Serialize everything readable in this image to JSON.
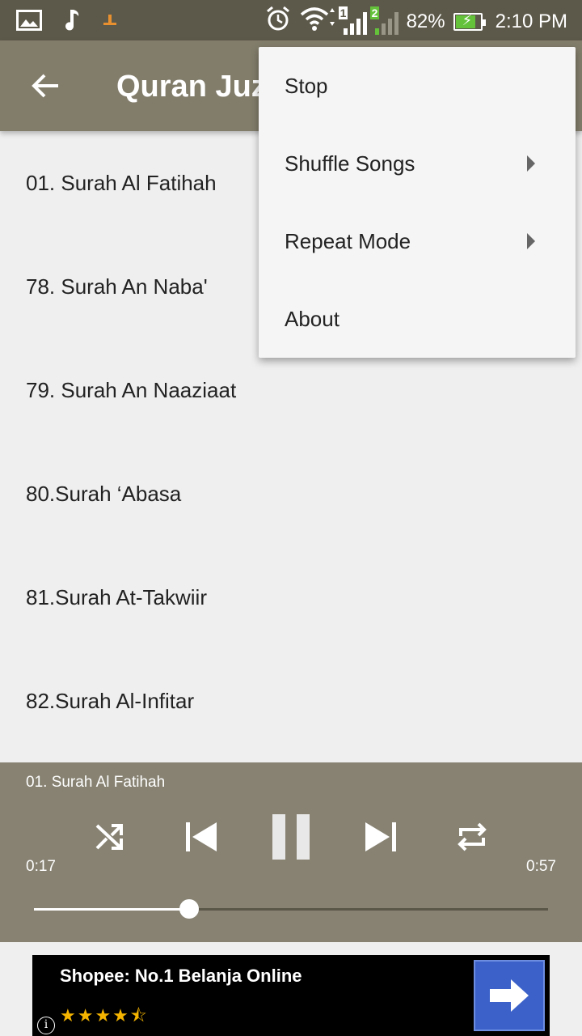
{
  "status_bar": {
    "battery": "82%",
    "time": "2:10 PM",
    "sim1": "1",
    "sim2": "2",
    "icons": [
      "gallery-icon",
      "music-note-icon",
      "notification-icon",
      "alarm-icon",
      "wifi-icon",
      "signal-icon",
      "battery-charging-icon"
    ],
    "battery_level": 0.82,
    "battery_color": "#64c23a"
  },
  "app_bar": {
    "title": "Quran Juz",
    "back_icon": "arrow-back-icon",
    "background": "#827d6b"
  },
  "tracks": [
    {
      "label": "01. Surah Al Fatihah"
    },
    {
      "label": "78. Surah An Naba'"
    },
    {
      "label": "79. Surah An Naaziaat"
    },
    {
      "label": "80.Surah ‘Abasa"
    },
    {
      "label": "81.Surah At-Takwiir"
    },
    {
      "label": "82.Surah Al-Infitar"
    }
  ],
  "menu": {
    "items": [
      {
        "label": "Stop",
        "has_submenu": false
      },
      {
        "label": "Shuffle Songs",
        "has_submenu": true
      },
      {
        "label": "Repeat Mode",
        "has_submenu": true
      },
      {
        "label": "About",
        "has_submenu": false
      }
    ]
  },
  "player": {
    "now_playing": "01. Surah Al Fatihah",
    "current_time": "0:17",
    "total_time": "0:57",
    "progress": 0.302,
    "state": "playing",
    "controls": [
      "shuffle-icon",
      "previous-icon",
      "pause-icon",
      "next-icon",
      "repeat-icon"
    ],
    "background": "#878272"
  },
  "ad": {
    "title": "Shopee: No.1 Belanja Online",
    "stars": "★★★★⯪",
    "rating": 4.5,
    "info": "i"
  }
}
